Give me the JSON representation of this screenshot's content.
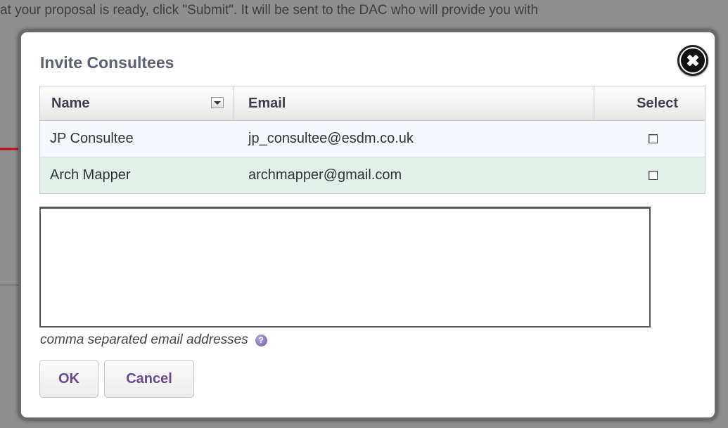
{
  "background": {
    "lines": [
      "at your proposal is ready, click \"Submit\". It will be sent to the DAC who will provide you with"
    ]
  },
  "dialog": {
    "title": "Invite Consultees",
    "table": {
      "headers": {
        "name": "Name",
        "email": "Email",
        "select": "Select"
      },
      "rows": [
        {
          "name": "JP Consultee",
          "email": "jp_consultee@esdm.co.uk",
          "selected": false
        },
        {
          "name": "Arch Mapper",
          "email": "archmapper@gmail.com",
          "selected": false
        }
      ]
    },
    "emails_value": "",
    "hint": "comma separated email addresses",
    "help_icon": "?",
    "ok_label": "OK",
    "cancel_label": "Cancel"
  },
  "colors": {
    "accent": "#6a4a8c",
    "title": "#5b6172",
    "row_alt": "#e3f0ea",
    "annotation_arrow": "#d0021b"
  }
}
